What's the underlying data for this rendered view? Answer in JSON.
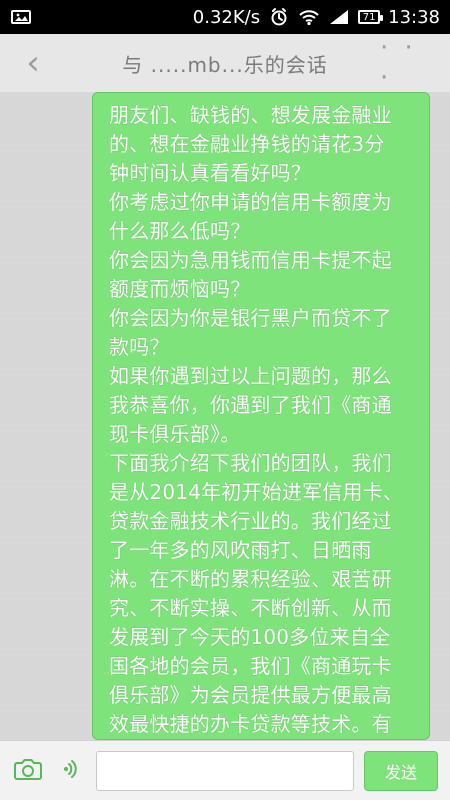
{
  "status_bar": {
    "network_speed": "0.32K/s",
    "battery_level": "71",
    "time": "13:38",
    "icons": [
      "alarm-icon",
      "wifi-icon",
      "signal-icon",
      "battery-icon"
    ]
  },
  "titlebar": {
    "title": "与 .....mb...乐的会话",
    "more_label": "· · ·"
  },
  "chat": {
    "message_text": "朋友们、缺钱的、想发展金融业\n的、想在金融业挣钱的请花3分\n钟时间认真看看好吗？\n你考虑过你申请的信用卡额度为\n什么那么低吗？\n你会因为急用钱而信用卡提不起\n额度而烦恼吗？\n你会因为你是银行黑户而贷不了\n款吗？\n如果你遇到过以上问题的，那么\n我恭喜你，你遇到了我们《商通\n现卡俱乐部》。\n下面我介绍下我们的团队，我们\n是从2014年初开始进军信用卡、\n贷款金融技术行业的。我们经过\n了一年多的风吹雨打、日晒雨\n淋。在不断的累积经验、艰苦研\n究、不断实操、不断创新、从而\n发展到了今天的100多位来自全\n国各地的会员，我们《商通玩卡\n俱乐部》为会员提供最方便最高\n效最快捷的办卡贷款等技术。有"
  },
  "input_bar": {
    "placeholder": "",
    "send_label": "发送",
    "icons": [
      "camera-icon",
      "voice-icon"
    ]
  },
  "colors": {
    "bubble": "#7ee37b",
    "send_button": "#7ee37b",
    "accent": "#55b95a"
  }
}
